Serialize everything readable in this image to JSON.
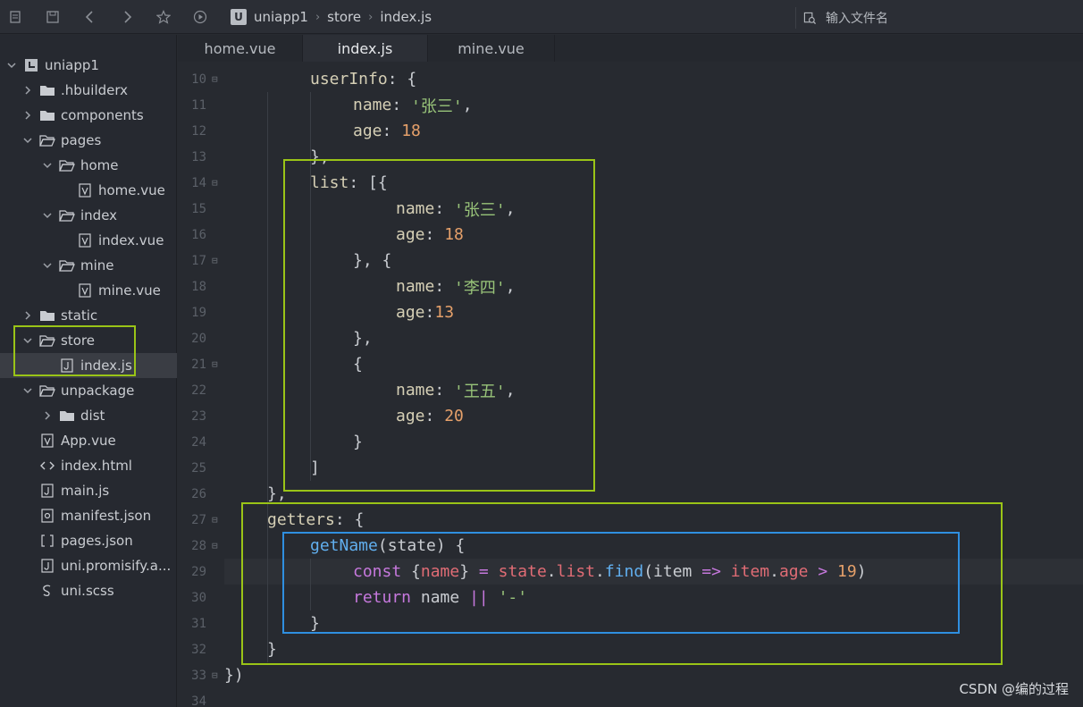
{
  "toolbar": {
    "breadcrumb": [
      "uniapp1",
      "store",
      "index.js"
    ],
    "logo_letter": "U",
    "search_placeholder": "输入文件名"
  },
  "sidebar": {
    "items": [
      {
        "label": "uniapp1",
        "depth": 0,
        "expanded": true,
        "icon": "project-icon"
      },
      {
        "label": ".hbuilderx",
        "depth": 1,
        "expanded": false,
        "icon": "folder-icon"
      },
      {
        "label": "components",
        "depth": 1,
        "expanded": false,
        "icon": "folder-icon"
      },
      {
        "label": "pages",
        "depth": 1,
        "expanded": true,
        "icon": "folder-open-icon"
      },
      {
        "label": "home",
        "depth": 2,
        "expanded": true,
        "icon": "folder-open-icon"
      },
      {
        "label": "home.vue",
        "depth": 3,
        "icon": "vue-file-icon"
      },
      {
        "label": "index",
        "depth": 2,
        "expanded": true,
        "icon": "folder-open-icon"
      },
      {
        "label": "index.vue",
        "depth": 3,
        "icon": "vue-file-icon"
      },
      {
        "label": "mine",
        "depth": 2,
        "expanded": true,
        "icon": "folder-open-icon"
      },
      {
        "label": "mine.vue",
        "depth": 3,
        "icon": "vue-file-icon"
      },
      {
        "label": "static",
        "depth": 1,
        "expanded": false,
        "icon": "folder-icon"
      },
      {
        "label": "store",
        "depth": 1,
        "expanded": true,
        "icon": "folder-open-icon"
      },
      {
        "label": "index.js",
        "depth": 2,
        "icon": "js-file-icon",
        "selected": true
      },
      {
        "label": "unpackage",
        "depth": 1,
        "expanded": true,
        "icon": "folder-open-icon"
      },
      {
        "label": "dist",
        "depth": 2,
        "expanded": false,
        "icon": "folder-icon"
      },
      {
        "label": "App.vue",
        "depth": 1,
        "icon": "vue-file-icon"
      },
      {
        "label": "index.html",
        "depth": 1,
        "icon": "html-file-icon"
      },
      {
        "label": "main.js",
        "depth": 1,
        "icon": "js-file-icon"
      },
      {
        "label": "manifest.json",
        "depth": 1,
        "icon": "manifest-icon"
      },
      {
        "label": "pages.json",
        "depth": 1,
        "icon": "json-file-icon"
      },
      {
        "label": "uni.promisify.a...",
        "depth": 1,
        "icon": "js-file-icon"
      },
      {
        "label": "uni.scss",
        "depth": 1,
        "icon": "scss-file-icon"
      }
    ]
  },
  "tabs": [
    {
      "label": "home.vue",
      "active": false
    },
    {
      "label": "index.js",
      "active": true
    },
    {
      "label": "mine.vue",
      "active": false
    }
  ],
  "editor": {
    "lines": [
      {
        "num": "10",
        "fold": true,
        "indent": 2,
        "tokens": [
          [
            "pr",
            "userInfo"
          ],
          [
            "p",
            ": {"
          ]
        ]
      },
      {
        "num": "11",
        "indent": 3,
        "tokens": [
          [
            "pr",
            "name"
          ],
          [
            "p",
            ": "
          ],
          [
            "s",
            "'张三'"
          ],
          [
            "p",
            ","
          ]
        ]
      },
      {
        "num": "12",
        "indent": 3,
        "tokens": [
          [
            "pr",
            "age"
          ],
          [
            "p",
            ": "
          ],
          [
            "n",
            "18"
          ]
        ]
      },
      {
        "num": "13",
        "indent": 2,
        "tokens": [
          [
            "p",
            "},"
          ]
        ]
      },
      {
        "num": "14",
        "fold": true,
        "indent": 2,
        "tokens": [
          [
            "pr",
            "list"
          ],
          [
            "p",
            ": [{"
          ]
        ]
      },
      {
        "num": "15",
        "indent": 4,
        "tokens": [
          [
            "pr",
            "name"
          ],
          [
            "p",
            ": "
          ],
          [
            "s",
            "'张三'"
          ],
          [
            "p",
            ","
          ]
        ]
      },
      {
        "num": "16",
        "indent": 4,
        "tokens": [
          [
            "pr",
            "age"
          ],
          [
            "p",
            ": "
          ],
          [
            "n",
            "18"
          ]
        ]
      },
      {
        "num": "17",
        "fold": true,
        "indent": 3,
        "tokens": [
          [
            "p",
            "}, {"
          ]
        ]
      },
      {
        "num": "18",
        "indent": 4,
        "tokens": [
          [
            "pr",
            "name"
          ],
          [
            "p",
            ": "
          ],
          [
            "s",
            "'李四'"
          ],
          [
            "p",
            ","
          ]
        ]
      },
      {
        "num": "19",
        "indent": 4,
        "tokens": [
          [
            "pr",
            "age"
          ],
          [
            "p",
            ":"
          ],
          [
            "n",
            "13"
          ]
        ]
      },
      {
        "num": "20",
        "indent": 3,
        "tokens": [
          [
            "p",
            "},"
          ]
        ]
      },
      {
        "num": "21",
        "fold": true,
        "indent": 3,
        "tokens": [
          [
            "p",
            "{"
          ]
        ]
      },
      {
        "num": "22",
        "indent": 4,
        "tokens": [
          [
            "pr",
            "name"
          ],
          [
            "p",
            ": "
          ],
          [
            "s",
            "'王五'"
          ],
          [
            "p",
            ","
          ]
        ]
      },
      {
        "num": "23",
        "indent": 4,
        "tokens": [
          [
            "pr",
            "age"
          ],
          [
            "p",
            ": "
          ],
          [
            "n",
            "20"
          ]
        ]
      },
      {
        "num": "24",
        "indent": 3,
        "tokens": [
          [
            "p",
            "}"
          ]
        ]
      },
      {
        "num": "25",
        "indent": 2,
        "tokens": [
          [
            "p",
            "]"
          ]
        ]
      },
      {
        "num": "26",
        "indent": 1,
        "tokens": [
          [
            "p",
            "},"
          ]
        ]
      },
      {
        "num": "27",
        "fold": true,
        "indent": 1,
        "tokens": [
          [
            "pr",
            "getters"
          ],
          [
            "p",
            ": {"
          ]
        ]
      },
      {
        "num": "28",
        "fold": true,
        "indent": 2,
        "tokens": [
          [
            "f",
            "getName"
          ],
          [
            "p",
            "(state) {"
          ]
        ]
      },
      {
        "num": "29",
        "indent": 3,
        "current": true,
        "tokens": [
          [
            "k",
            "const"
          ],
          [
            "p",
            " {"
          ],
          [
            "v",
            "name"
          ],
          [
            "p",
            "} "
          ],
          [
            "o",
            "="
          ],
          [
            "p",
            " "
          ],
          [
            "v",
            "state"
          ],
          [
            "p",
            "."
          ],
          [
            "v",
            "list"
          ],
          [
            "p",
            "."
          ],
          [
            "f",
            "find"
          ],
          [
            "p",
            "(item "
          ],
          [
            "o",
            "=>"
          ],
          [
            "p",
            " "
          ],
          [
            "v",
            "item"
          ],
          [
            "p",
            "."
          ],
          [
            "v",
            "age"
          ],
          [
            "p",
            " "
          ],
          [
            "o",
            ">"
          ],
          [
            "p",
            " "
          ],
          [
            "n",
            "19"
          ],
          [
            "p",
            ")"
          ]
        ]
      },
      {
        "num": "30",
        "indent": 3,
        "tokens": [
          [
            "k",
            "return"
          ],
          [
            "p",
            " name "
          ],
          [
            "o",
            "||"
          ],
          [
            "p",
            " "
          ],
          [
            "s",
            "'-'"
          ]
        ]
      },
      {
        "num": "31",
        "indent": 2,
        "tokens": [
          [
            "p",
            "}"
          ]
        ]
      },
      {
        "num": "32",
        "indent": 1,
        "tokens": [
          [
            "p",
            "}"
          ]
        ]
      },
      {
        "num": "33",
        "fold": true,
        "indent": 0,
        "tokens": [
          [
            "p",
            "})"
          ]
        ]
      },
      {
        "num": "34",
        "indent": 0,
        "tokens": []
      }
    ]
  },
  "annotations": {
    "sidebar_box_color": "#9ac417",
    "list_box_color": "#9ac417",
    "getters_box_color": "#9ac417",
    "getName_box_color": "#2f8fe0"
  },
  "watermark": "CSDN @编的过程"
}
